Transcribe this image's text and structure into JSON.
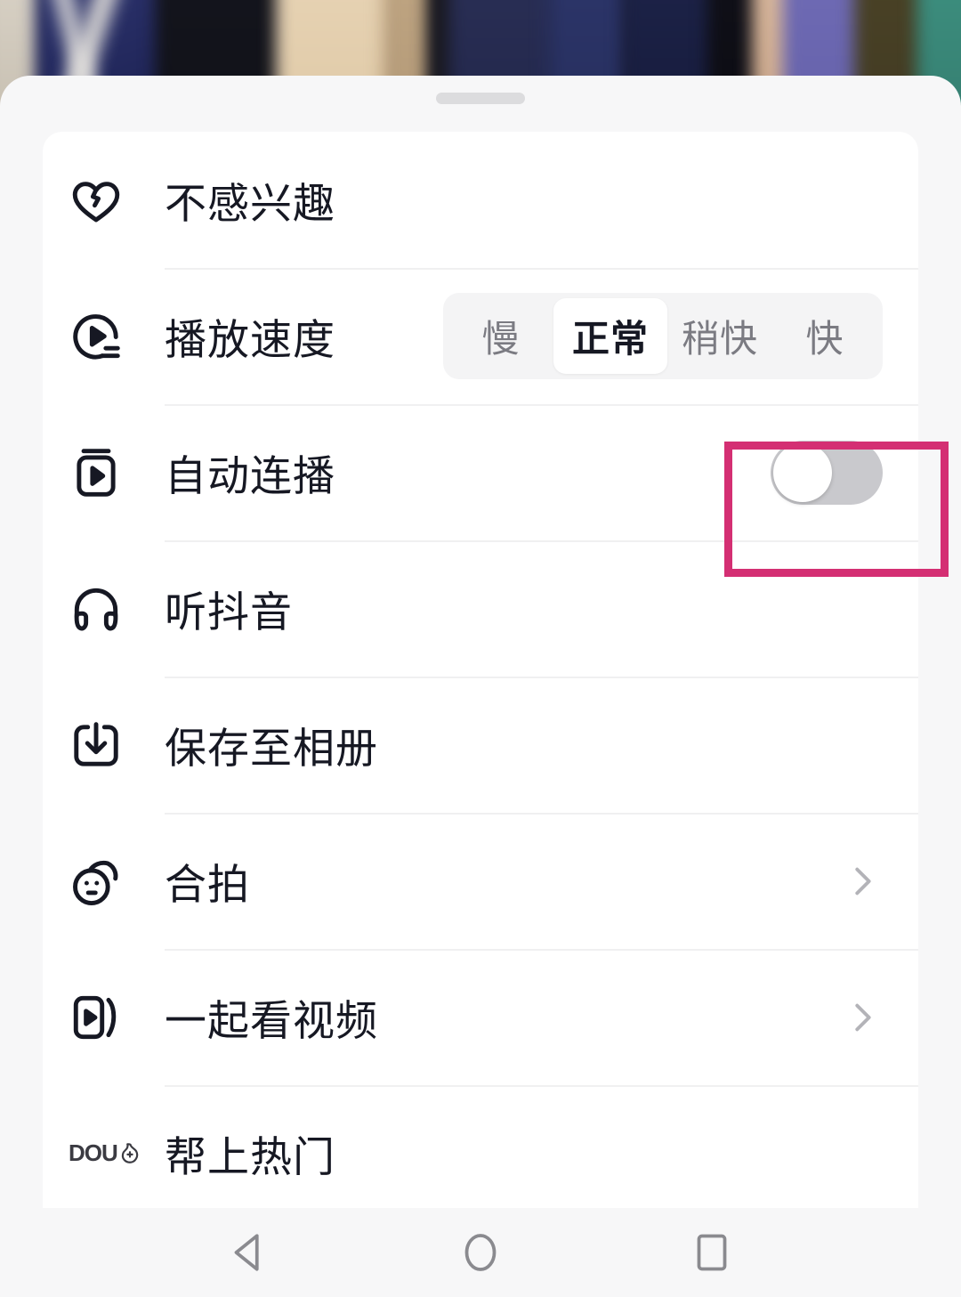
{
  "app": {
    "surface": "douyin-video-more-options-sheet",
    "background_description": "blurred video frame of a row of people standing"
  },
  "sheet": {
    "drag_handle": "drag-handle"
  },
  "menu": {
    "items": [
      {
        "id": "not-interested",
        "label": "不感兴趣",
        "icon": "broken-heart-icon",
        "control": "none"
      },
      {
        "id": "playback-speed",
        "label": "播放速度",
        "icon": "play-speed-icon",
        "control": "segmented"
      },
      {
        "id": "auto-play-next",
        "label": "自动连播",
        "icon": "auto-play-icon",
        "control": "toggle"
      },
      {
        "id": "listen-douyin",
        "label": "听抖音",
        "icon": "headphones-icon",
        "control": "none"
      },
      {
        "id": "save-to-album",
        "label": "保存至相册",
        "icon": "download-icon",
        "control": "none"
      },
      {
        "id": "duet",
        "label": "合拍",
        "icon": "duet-face-icon",
        "control": "chevron"
      },
      {
        "id": "watch-together",
        "label": "一起看视频",
        "icon": "watch-together-icon",
        "control": "chevron"
      },
      {
        "id": "promote-trending",
        "label": "帮上热门",
        "icon": "dou-plus-icon",
        "control": "none"
      }
    ]
  },
  "speed_control": {
    "options": [
      {
        "label": "慢",
        "selected": false
      },
      {
        "label": "正常",
        "selected": true
      },
      {
        "label": "稍快",
        "selected": false
      },
      {
        "label": "快",
        "selected": false
      }
    ],
    "selected_value": "正常"
  },
  "auto_play_toggle": {
    "state": "off",
    "track_color": "#c9c9cd",
    "knob_color": "#ffffff"
  },
  "annotation": {
    "type": "highlight-rectangle",
    "target": "auto-play-next-toggle",
    "color": "#d42f73"
  },
  "dou_plus_logo": {
    "text": "DOU",
    "mark": "+"
  },
  "navbar": {
    "buttons": [
      {
        "id": "back",
        "icon": "back-triangle-icon"
      },
      {
        "id": "home",
        "icon": "home-circle-icon"
      },
      {
        "id": "recents",
        "icon": "recents-square-icon"
      }
    ],
    "color": "#8a8a8f"
  },
  "colors": {
    "sheet_bg": "#f7f7f8",
    "card_bg": "#ffffff",
    "text_primary": "#161823",
    "text_secondary": "#7b7b82",
    "divider": "#f0f0f1",
    "accent_annotation": "#d42f73"
  }
}
